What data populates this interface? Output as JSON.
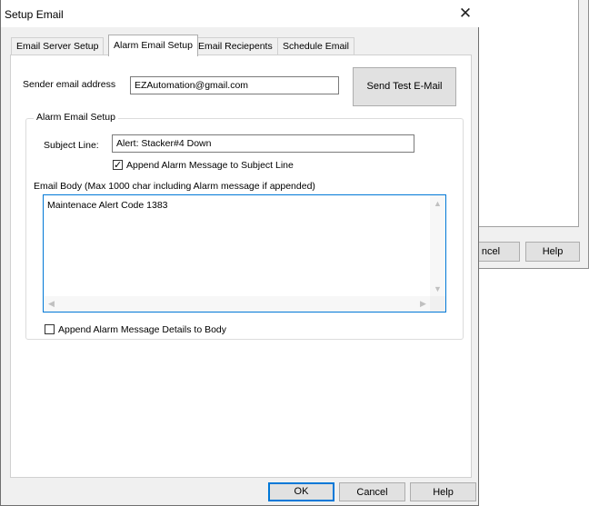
{
  "background_dialog": {
    "cancel_label": "ncel",
    "help_label": "Help"
  },
  "window": {
    "title": "Setup Email",
    "close_glyph": "✕"
  },
  "tabs": [
    {
      "label": "Email Server Setup"
    },
    {
      "label": "Alarm Email Setup"
    },
    {
      "label": "Email Reciepents"
    },
    {
      "label": "Schedule Email"
    }
  ],
  "sender": {
    "label": "Sender email address",
    "value": "EZAutomation@gmail.com"
  },
  "send_test_label": "Send Test E-Mail",
  "alarm_group": {
    "title": "Alarm Email Setup",
    "subject_label": "Subject Line:",
    "subject_value": "Alert: Stacker#4 Down",
    "append_subject_label": "Append Alarm Message to Subject Line",
    "append_subject_checked": true,
    "body_label": "Email Body (Max 1000 char including Alarm message if appended)",
    "body_value": "Maintenace Alert Code 1383",
    "append_details_label": "Append Alarm Message Details to Body",
    "append_details_checked": false
  },
  "footer": {
    "ok_label": "OK",
    "cancel_label": "Cancel",
    "help_label": "Help"
  },
  "icons": {
    "check": "check-icon",
    "close": "close-icon",
    "scroll_up": "scroll-up-icon",
    "scroll_down": "scroll-down-icon",
    "scroll_left": "scroll-left-icon",
    "scroll_right": "scroll-right-icon"
  },
  "colors": {
    "focus_border": "#0078d7",
    "dialog_bg": "#f0f0f0",
    "button_bg": "#e1e1e1"
  }
}
